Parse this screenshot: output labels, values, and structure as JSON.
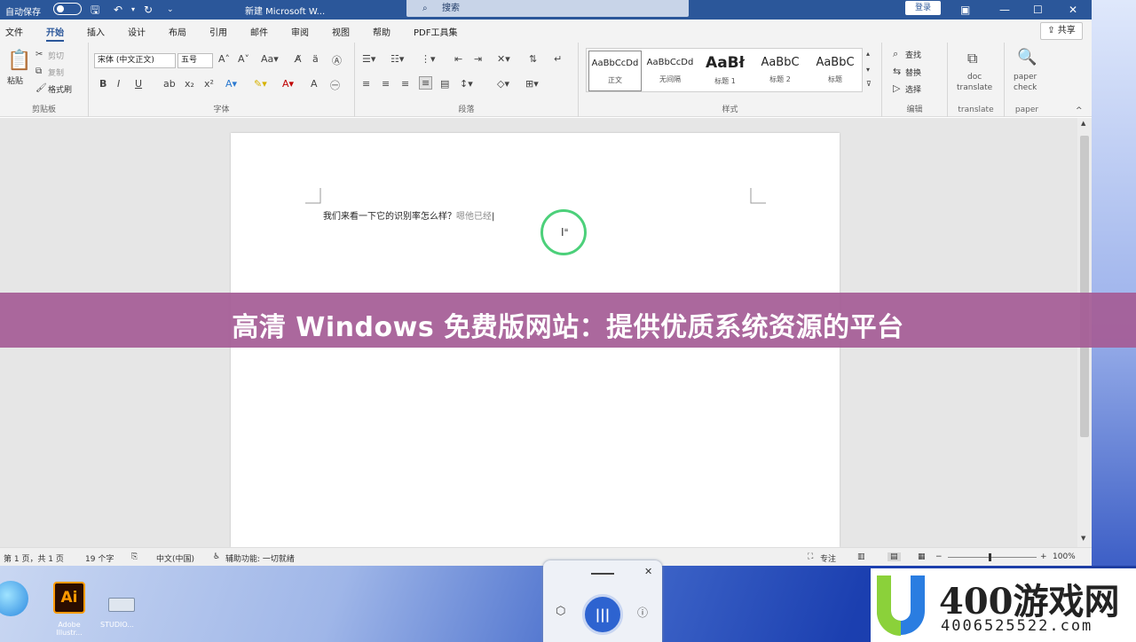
{
  "titlebar": {
    "autosave": "自动保存",
    "title": "新建 Microsoft W...",
    "search": "搜索",
    "login": "登录"
  },
  "menu": {
    "tabs": [
      "文件",
      "开始",
      "插入",
      "设计",
      "布局",
      "引用",
      "邮件",
      "审阅",
      "视图",
      "帮助",
      "PDF工具集"
    ],
    "share": "共享"
  },
  "ribbon": {
    "clipboard": {
      "paste": "粘贴",
      "cut": "剪切",
      "copy": "复制",
      "format_painter": "格式刷",
      "label": "剪贴板"
    },
    "font": {
      "name": "宋体 (中文正文)",
      "size": "五号",
      "label": "字体"
    },
    "paragraph": {
      "label": "段落"
    },
    "styles": {
      "items": [
        {
          "sample": "AaBbCcDd",
          "label": "正文"
        },
        {
          "sample": "AaBbCcDd",
          "label": "无间隔"
        },
        {
          "sample": "AaBł",
          "label": "标题 1"
        },
        {
          "sample": "AaBbC",
          "label": "标题 2"
        },
        {
          "sample": "AaBbC",
          "label": "标题"
        }
      ],
      "label": "样式"
    },
    "editing": {
      "find": "查找",
      "replace": "替换",
      "select": "选择",
      "label": "编辑"
    },
    "translate": {
      "line1": "doc",
      "line2": "translate",
      "label": "translate"
    },
    "paper": {
      "line1": "paper",
      "line2": "check",
      "label": "paper"
    }
  },
  "document": {
    "text": "我们来看一下它的识别率怎么样？",
    "pending": "嗯他已经"
  },
  "statusbar": {
    "page": "第 1 页，共 1 页",
    "words": "19 个字",
    "lang": "中文(中国)",
    "accessibility": "辅助功能: 一切就绪",
    "focus": "专注",
    "zoom": "100%"
  },
  "taskbar": {
    "ai_label": "Adobe Illustr...",
    "kb_label": "STUDIO..."
  },
  "banner": "高清 Windows 免费版网站：提供优质系统资源的平台",
  "watermark": {
    "main": "400游戏网",
    "sub": "4006525522.com"
  }
}
